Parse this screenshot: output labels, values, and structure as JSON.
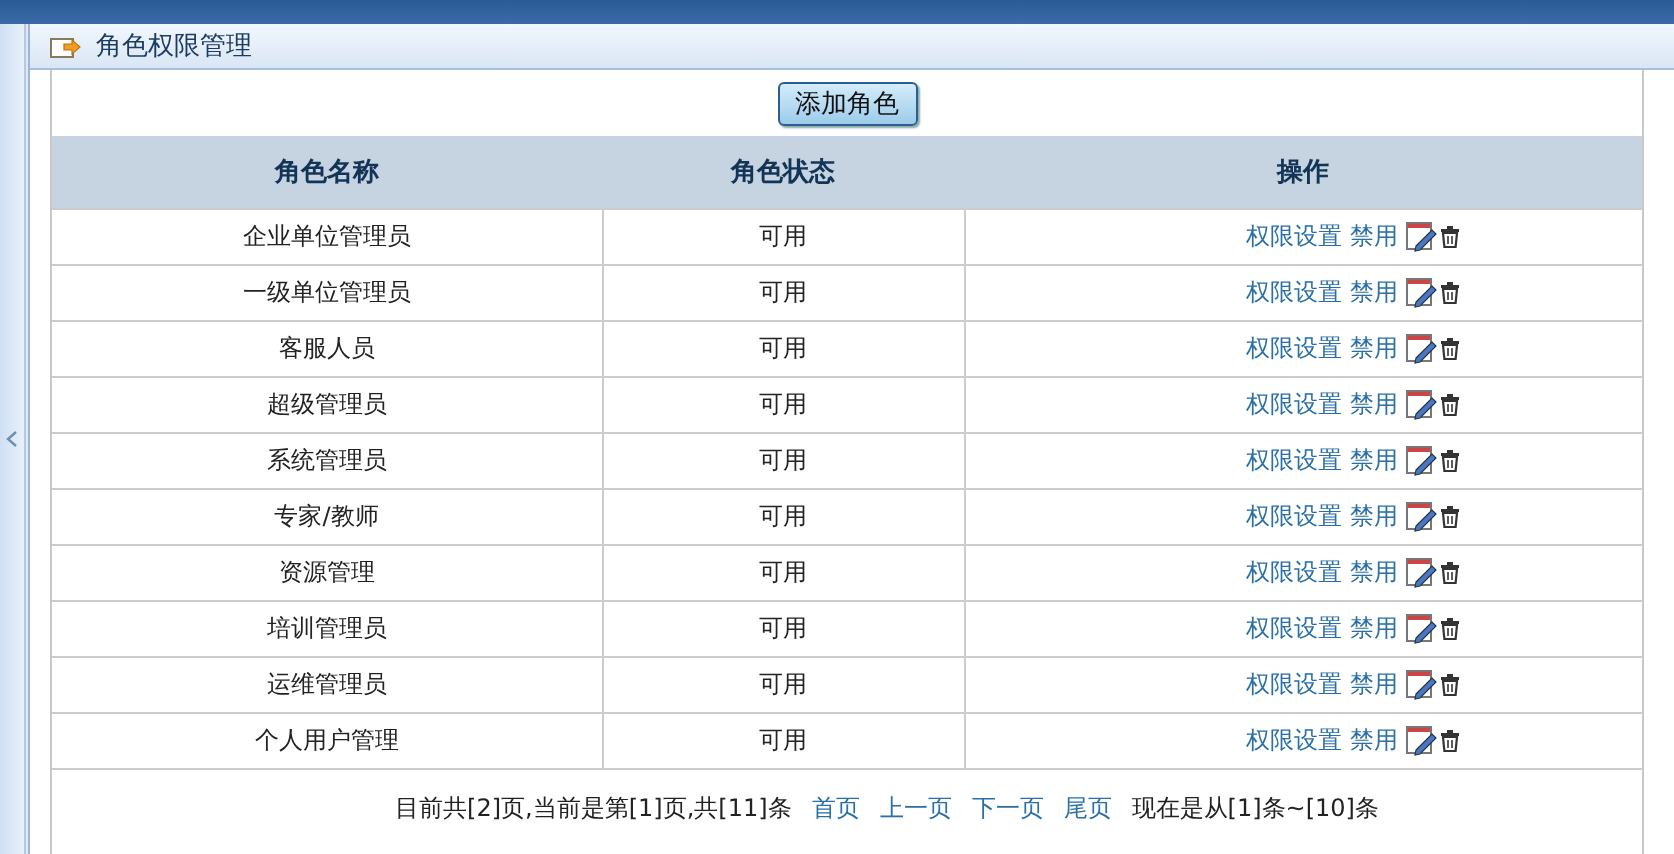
{
  "panel": {
    "title": "角色权限管理"
  },
  "add_button": "添加角色",
  "table": {
    "columns": [
      "角色名称",
      "角色状态",
      "操作"
    ],
    "rows": [
      {
        "name": "企业单位管理员",
        "status": "可用",
        "permission_link": "权限设置",
        "disable_link": "禁用"
      },
      {
        "name": "一级单位管理员",
        "status": "可用",
        "permission_link": "权限设置",
        "disable_link": "禁用"
      },
      {
        "name": "客服人员",
        "status": "可用",
        "permission_link": "权限设置",
        "disable_link": "禁用"
      },
      {
        "name": "超级管理员",
        "status": "可用",
        "permission_link": "权限设置",
        "disable_link": "禁用"
      },
      {
        "name": "系统管理员",
        "status": "可用",
        "permission_link": "权限设置",
        "disable_link": "禁用"
      },
      {
        "name": "专家/教师",
        "status": "可用",
        "permission_link": "权限设置",
        "disable_link": "禁用"
      },
      {
        "name": "资源管理",
        "status": "可用",
        "permission_link": "权限设置",
        "disable_link": "禁用"
      },
      {
        "name": "培训管理员",
        "status": "可用",
        "permission_link": "权限设置",
        "disable_link": "禁用"
      },
      {
        "name": "运维管理员",
        "status": "可用",
        "permission_link": "权限设置",
        "disable_link": "禁用"
      },
      {
        "name": "个人用户管理",
        "status": "可用",
        "permission_link": "权限设置",
        "disable_link": "禁用"
      }
    ]
  },
  "pagination": {
    "summary": "目前共[2]页,当前是第[1]页,共[11]条",
    "links": [
      "首页",
      "上一页",
      "下一页",
      "尾页"
    ],
    "range": "现在是从[1]条~[10]条"
  }
}
